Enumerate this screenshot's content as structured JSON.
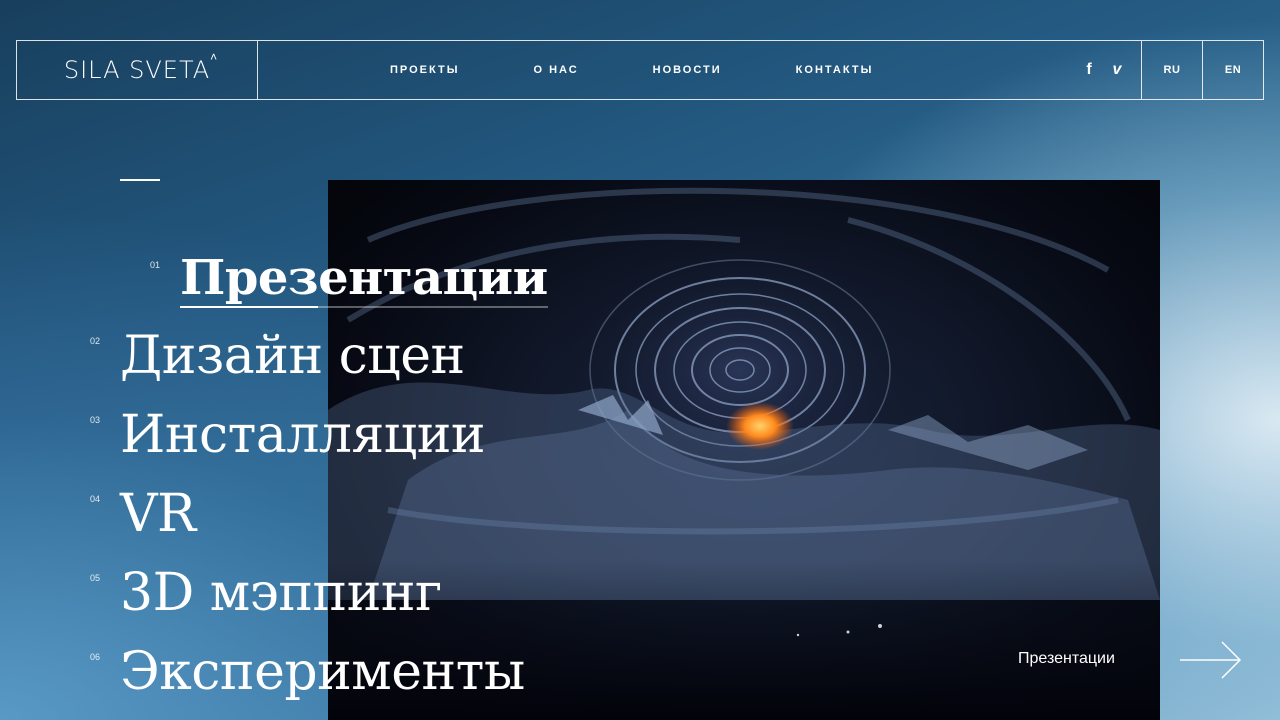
{
  "header": {
    "logo": "SILA SVETA",
    "logo_mark": "˄",
    "nav": [
      "ПРОЕКТЫ",
      "О НАС",
      "НОВОСТИ",
      "КОНТАКТЫ"
    ],
    "social": [
      {
        "icon": "facebook-icon",
        "glyph": "f"
      },
      {
        "icon": "vimeo-icon",
        "glyph": "v"
      }
    ],
    "languages": [
      "RU",
      "EN"
    ]
  },
  "categories": [
    {
      "num": "01",
      "label": "Презентации",
      "active": true
    },
    {
      "num": "02",
      "label": "Дизайн сцен",
      "active": false
    },
    {
      "num": "03",
      "label": "Инсталляции",
      "active": false
    },
    {
      "num": "04",
      "label": "VR",
      "active": false
    },
    {
      "num": "05",
      "label": "3D мэппинг",
      "active": false
    },
    {
      "num": "06",
      "label": "Эксперименты",
      "active": false
    }
  ],
  "hero": {
    "caption": "Презентации"
  },
  "colors": {
    "accent": "#ffffff",
    "bg_dark": "#183f5d",
    "bg_light": "#8ebbd6",
    "fire": "#ff8a1e"
  }
}
